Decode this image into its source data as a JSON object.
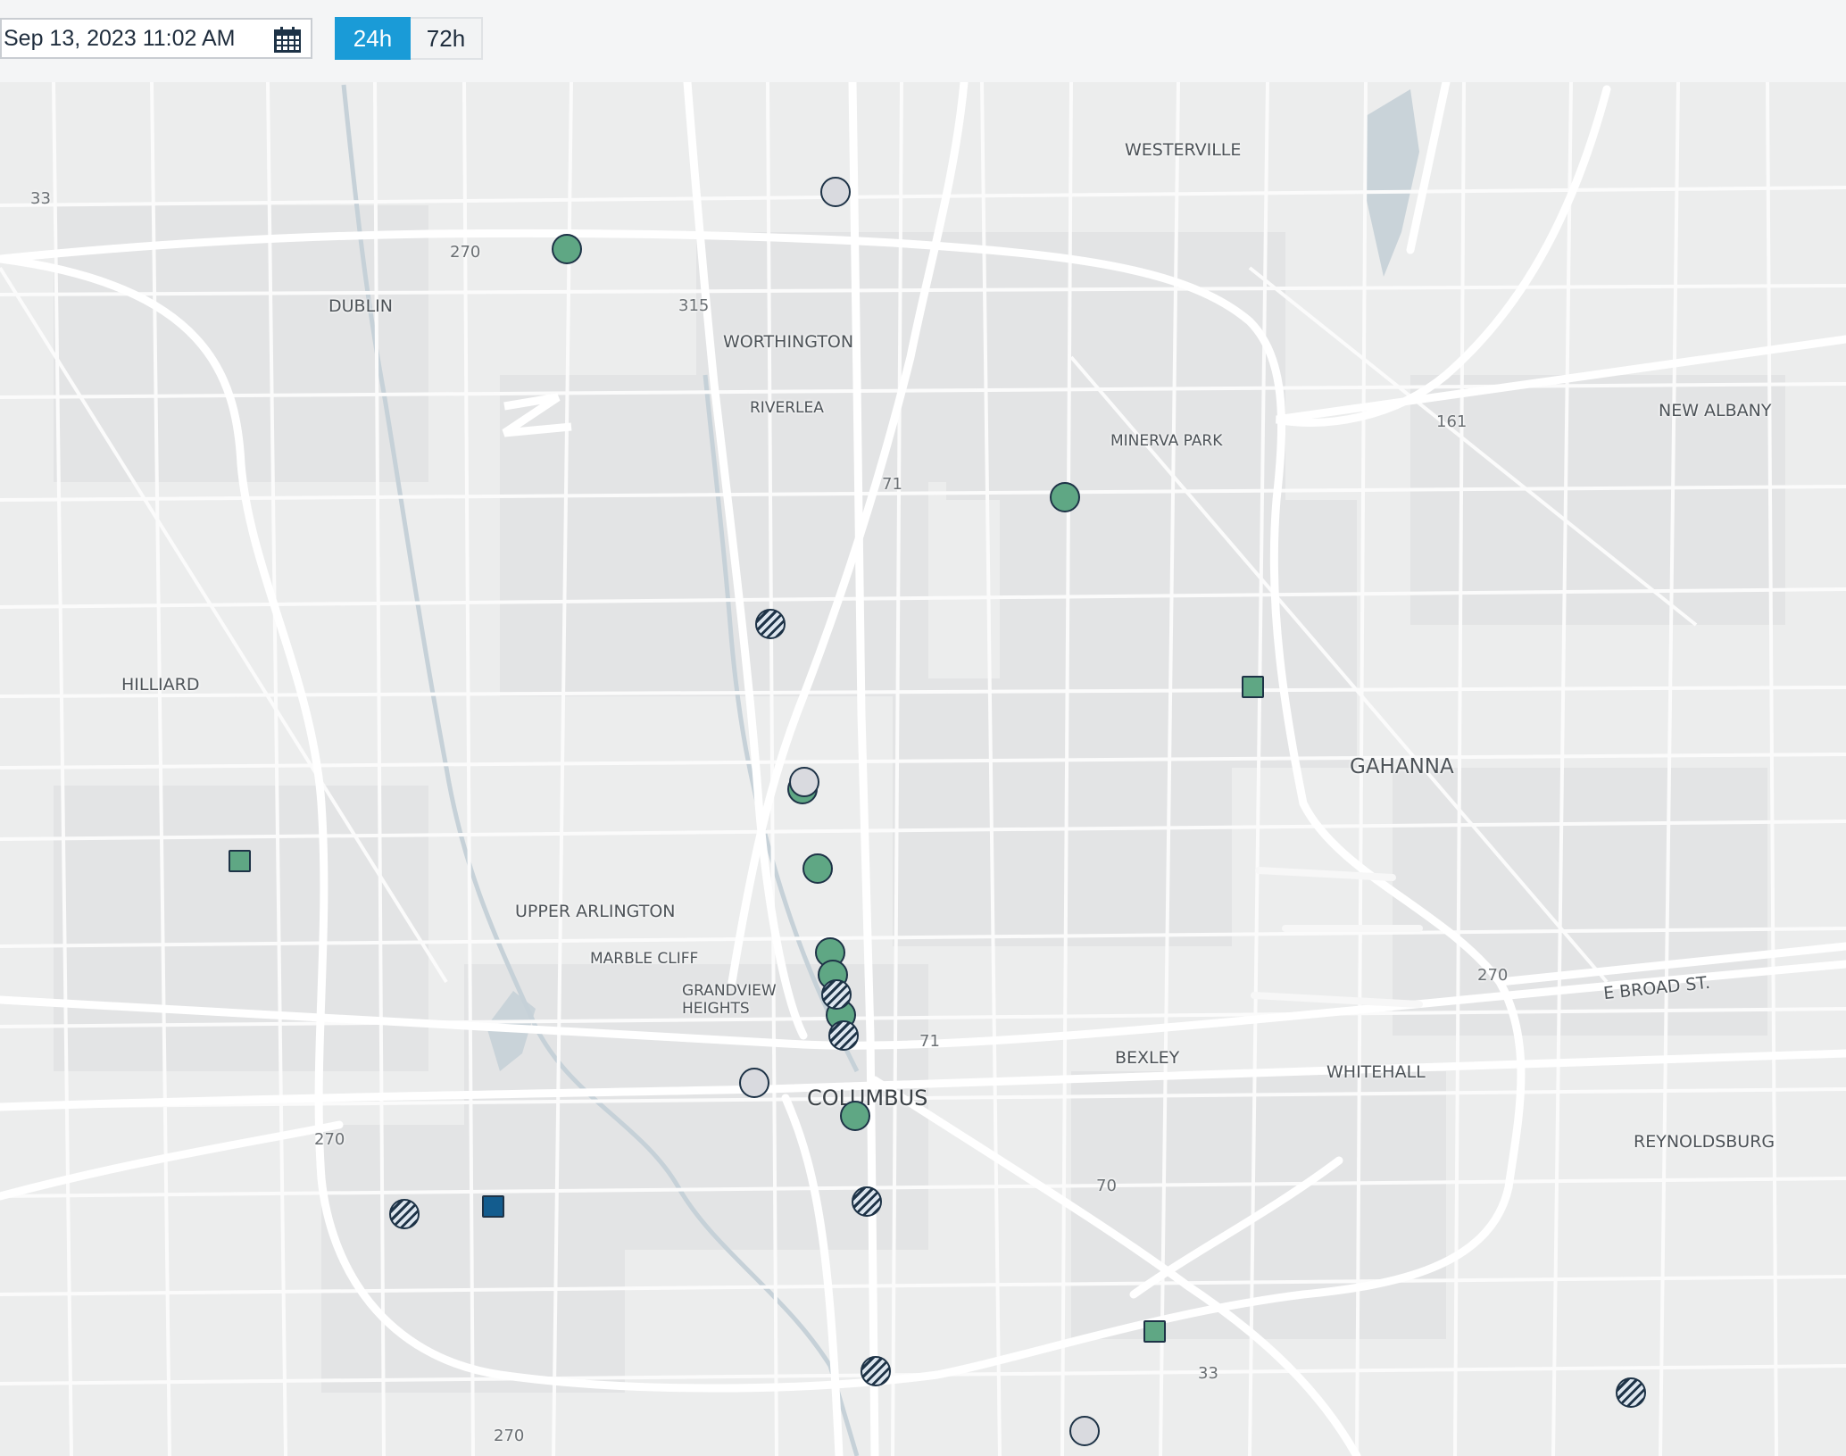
{
  "toolbar": {
    "datetime_value": "Sep 13, 2023 11:02 AM",
    "calendar_icon": "calendar-icon",
    "range_options": [
      "24h",
      "72h"
    ],
    "selected_range": "24h"
  },
  "map": {
    "place_labels": {
      "westerville": "WESTERVILLE",
      "dublin": "DUBLIN",
      "worthington": "WORTHINGTON",
      "riverlea": "RIVERLEA",
      "minerva_park": "MINERVA PARK",
      "new_albany": "NEW ALBANY",
      "hilliard": "HILLIARD",
      "gahanna": "GAHANNA",
      "upper_arlington": "UPPER ARLINGTON",
      "marble_cliff": "MARBLE CLIFF",
      "grandview_1": "GRANDVIEW",
      "grandview_2": "HEIGHTS",
      "columbus": "COLUMBUS",
      "bexley": "BEXLEY",
      "whitehall": "WHITEHALL",
      "reynoldsburg": "REYNOLDSBURG",
      "e_broad": "E BROAD ST."
    },
    "route_labels": {
      "r33_nw": "33",
      "r270_nw": "270",
      "r315": "315",
      "r71_n": "71",
      "r161": "161",
      "r270_e": "270",
      "r71_c": "71",
      "r270_sw": "270",
      "r70": "70",
      "r33_se": "33",
      "r270_s": "270"
    },
    "colors": {
      "active_button": "#1a9bd7",
      "marker_green": "#5fa784",
      "marker_grey": "#d9dadf",
      "marker_blue": "#135c8e",
      "marker_outline": "#1e3347"
    }
  }
}
